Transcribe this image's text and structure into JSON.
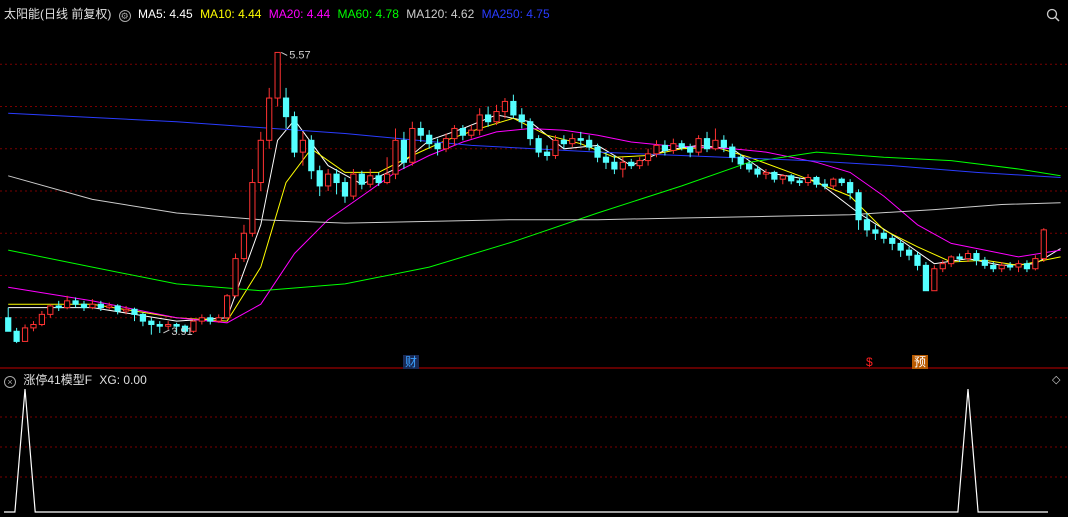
{
  "header": {
    "title": "太阳能(日线 前复权)",
    "ma_items": [
      {
        "label": "MA5: 4.45",
        "color": "#ffffff"
      },
      {
        "label": "MA10: 4.44",
        "color": "#ffff00"
      },
      {
        "label": "MA20: 4.44",
        "color": "#ff00ff"
      },
      {
        "label": "MA60: 4.78",
        "color": "#00ff00"
      },
      {
        "label": "MA120: 4.62",
        "color": "#cccccc"
      },
      {
        "label": "MA250: 4.75",
        "color": "#3355ff"
      }
    ],
    "settings_icon": "gear-circle-icon",
    "zoom_icon": "magnifier-icon"
  },
  "sub_panel": {
    "title": "涨停41模型F",
    "value_label": "XG: 0.00",
    "zoom_icon": "diamond-icon"
  },
  "events": [
    {
      "label": "财",
      "color": "#3aa0ff",
      "bg": "#1a2a55"
    },
    {
      "label": "$",
      "color": "#ff2020",
      "bg": "transparent"
    },
    {
      "label": "预",
      "color": "#ffffff",
      "bg": "#b85a00"
    }
  ],
  "chart_data": {
    "type": "candlestick",
    "ylim": [
      3.75,
      5.75
    ],
    "high_marker": {
      "label": "5.57",
      "value": 5.57
    },
    "low_marker": {
      "label": "3.91",
      "value": 3.91
    },
    "candles": [
      [
        4.0,
        3.92,
        4.06,
        3.92
      ],
      [
        3.92,
        3.86,
        3.94,
        3.85
      ],
      [
        3.86,
        3.94,
        3.96,
        3.86
      ],
      [
        3.94,
        3.96,
        3.98,
        3.92
      ],
      [
        3.96,
        4.02,
        4.04,
        3.95
      ],
      [
        4.02,
        4.07,
        4.08,
        4.0
      ],
      [
        4.07,
        4.06,
        4.1,
        4.04
      ],
      [
        4.06,
        4.1,
        4.13,
        4.05
      ],
      [
        4.1,
        4.08,
        4.12,
        4.06
      ],
      [
        4.08,
        4.06,
        4.1,
        4.04
      ],
      [
        4.06,
        4.08,
        4.11,
        4.05
      ],
      [
        4.08,
        4.06,
        4.1,
        4.04
      ],
      [
        4.06,
        4.07,
        4.09,
        4.05
      ],
      [
        4.07,
        4.04,
        4.08,
        4.02
      ],
      [
        4.04,
        4.05,
        4.07,
        4.02
      ],
      [
        4.05,
        4.02,
        4.06,
        3.98
      ],
      [
        4.02,
        3.98,
        4.03,
        3.95
      ],
      [
        3.98,
        3.96,
        4.0,
        3.9
      ],
      [
        3.96,
        3.95,
        3.98,
        3.91
      ],
      [
        3.95,
        3.96,
        3.98,
        3.93
      ],
      [
        3.96,
        3.95,
        3.97,
        3.91
      ],
      [
        3.95,
        3.92,
        3.96,
        3.91
      ],
      [
        3.92,
        3.98,
        3.99,
        3.91
      ],
      [
        3.98,
        4.0,
        4.02,
        3.96
      ],
      [
        4.0,
        3.98,
        4.02,
        3.96
      ],
      [
        3.98,
        4.0,
        4.02,
        3.97
      ],
      [
        4.0,
        4.13,
        4.14,
        3.99
      ],
      [
        4.13,
        4.35,
        4.38,
        4.12
      ],
      [
        4.35,
        4.5,
        4.55,
        4.33
      ],
      [
        4.5,
        4.8,
        4.88,
        4.48
      ],
      [
        4.8,
        5.05,
        5.1,
        4.75
      ],
      [
        5.05,
        5.3,
        5.36,
        5.0
      ],
      [
        5.3,
        5.57,
        5.57,
        5.25
      ],
      [
        5.3,
        5.19,
        5.36,
        5.12
      ],
      [
        5.19,
        4.98,
        5.22,
        4.95
      ],
      [
        4.98,
        5.05,
        5.1,
        4.9
      ],
      [
        5.05,
        4.87,
        5.08,
        4.82
      ],
      [
        4.87,
        4.78,
        4.9,
        4.72
      ],
      [
        4.78,
        4.85,
        4.88,
        4.75
      ],
      [
        4.85,
        4.8,
        4.88,
        4.73
      ],
      [
        4.8,
        4.72,
        4.83,
        4.68
      ],
      [
        4.72,
        4.85,
        4.88,
        4.7
      ],
      [
        4.85,
        4.79,
        4.87,
        4.76
      ],
      [
        4.79,
        4.84,
        4.88,
        4.77
      ],
      [
        4.84,
        4.8,
        4.86,
        4.78
      ],
      [
        4.8,
        4.85,
        4.95,
        4.79
      ],
      [
        4.85,
        5.05,
        5.12,
        4.82
      ],
      [
        5.05,
        4.92,
        5.1,
        4.88
      ],
      [
        4.92,
        5.12,
        5.16,
        4.9
      ],
      [
        5.12,
        5.08,
        5.16,
        5.04
      ],
      [
        5.08,
        5.03,
        5.11,
        5.0
      ],
      [
        5.03,
        5.0,
        5.06,
        4.96
      ],
      [
        5.0,
        5.06,
        5.09,
        4.98
      ],
      [
        5.06,
        5.12,
        5.14,
        5.02
      ],
      [
        5.12,
        5.08,
        5.14,
        5.05
      ],
      [
        5.08,
        5.11,
        5.14,
        5.06
      ],
      [
        5.11,
        5.2,
        5.24,
        5.08
      ],
      [
        5.2,
        5.16,
        5.25,
        5.13
      ],
      [
        5.16,
        5.22,
        5.26,
        5.14
      ],
      [
        5.22,
        5.28,
        5.3,
        5.18
      ],
      [
        5.28,
        5.2,
        5.32,
        5.18
      ],
      [
        5.2,
        5.16,
        5.24,
        5.12
      ],
      [
        5.16,
        5.06,
        5.18,
        5.02
      ],
      [
        5.06,
        4.98,
        5.08,
        4.95
      ],
      [
        4.98,
        4.96,
        5.02,
        4.93
      ],
      [
        4.96,
        5.05,
        5.08,
        4.94
      ],
      [
        5.05,
        5.03,
        5.08,
        5.0
      ],
      [
        5.03,
        5.06,
        5.09,
        5.01
      ],
      [
        5.06,
        5.05,
        5.1,
        5.02
      ],
      [
        5.05,
        5.01,
        5.08,
        4.99
      ],
      [
        5.01,
        4.95,
        5.03,
        4.92
      ],
      [
        4.95,
        4.92,
        4.98,
        4.88
      ],
      [
        4.92,
        4.88,
        4.96,
        4.85
      ],
      [
        4.88,
        4.92,
        4.95,
        4.83
      ],
      [
        4.92,
        4.9,
        4.94,
        4.88
      ],
      [
        4.9,
        4.93,
        4.95,
        4.88
      ],
      [
        4.93,
        4.97,
        5.0,
        4.9
      ],
      [
        4.97,
        5.02,
        5.05,
        4.95
      ],
      [
        5.02,
        4.99,
        5.05,
        4.96
      ],
      [
        4.99,
        5.03,
        5.06,
        4.97
      ],
      [
        5.03,
        5.01,
        5.05,
        4.99
      ],
      [
        5.01,
        4.98,
        5.03,
        4.95
      ],
      [
        4.98,
        5.06,
        5.08,
        4.96
      ],
      [
        5.06,
        5.0,
        5.1,
        4.98
      ],
      [
        5.0,
        5.05,
        5.12,
        4.99
      ],
      [
        5.05,
        5.01,
        5.08,
        4.98
      ],
      [
        5.01,
        4.95,
        5.03,
        4.92
      ],
      [
        4.95,
        4.91,
        4.97,
        4.88
      ],
      [
        4.91,
        4.88,
        4.93,
        4.86
      ],
      [
        4.88,
        4.85,
        4.9,
        4.83
      ],
      [
        4.85,
        4.86,
        4.88,
        4.82
      ],
      [
        4.86,
        4.82,
        4.87,
        4.8
      ],
      [
        4.82,
        4.84,
        4.85,
        4.79
      ],
      [
        4.84,
        4.81,
        4.85,
        4.79
      ],
      [
        4.81,
        4.8,
        4.83,
        4.78
      ],
      [
        4.8,
        4.83,
        4.85,
        4.78
      ],
      [
        4.83,
        4.79,
        4.84,
        4.77
      ],
      [
        4.79,
        4.78,
        4.82,
        4.76
      ],
      [
        4.78,
        4.82,
        4.83,
        4.76
      ],
      [
        4.82,
        4.8,
        4.83,
        4.78
      ],
      [
        4.8,
        4.74,
        4.82,
        4.7
      ],
      [
        4.74,
        4.58,
        4.76,
        4.52
      ],
      [
        4.58,
        4.52,
        4.62,
        4.48
      ],
      [
        4.52,
        4.5,
        4.55,
        4.46
      ],
      [
        4.5,
        4.47,
        4.52,
        4.44
      ],
      [
        4.47,
        4.44,
        4.49,
        4.4
      ],
      [
        4.44,
        4.4,
        4.46,
        4.36
      ],
      [
        4.4,
        4.37,
        4.42,
        4.34
      ],
      [
        4.37,
        4.31,
        4.39,
        4.28
      ],
      [
        4.31,
        4.16,
        4.33,
        4.16
      ],
      [
        4.16,
        4.29,
        4.31,
        4.16
      ],
      [
        4.29,
        4.32,
        4.34,
        4.27
      ],
      [
        4.32,
        4.36,
        4.37,
        4.3
      ],
      [
        4.36,
        4.35,
        4.38,
        4.33
      ],
      [
        4.35,
        4.38,
        4.4,
        4.33
      ],
      [
        4.38,
        4.34,
        4.4,
        4.31
      ],
      [
        4.34,
        4.31,
        4.36,
        4.29
      ],
      [
        4.31,
        4.29,
        4.33,
        4.27
      ],
      [
        4.29,
        4.31,
        4.33,
        4.27
      ],
      [
        4.31,
        4.3,
        4.33,
        4.28
      ],
      [
        4.3,
        4.32,
        4.34,
        4.27
      ],
      [
        4.32,
        4.29,
        4.34,
        4.27
      ],
      [
        4.29,
        4.35,
        4.37,
        4.28
      ],
      [
        4.35,
        4.52,
        4.53,
        4.33
      ]
    ],
    "ma_series": [
      {
        "name": "MA5",
        "color": "#ffffff",
        "points": [
          [
            0,
            4.06
          ],
          [
            10,
            4.06
          ],
          [
            20,
            3.98
          ],
          [
            26,
            4.0
          ],
          [
            30,
            4.55
          ],
          [
            32,
            5.05
          ],
          [
            34,
            5.17
          ],
          [
            38,
            4.9
          ],
          [
            42,
            4.79
          ],
          [
            46,
            4.88
          ],
          [
            50,
            5.05
          ],
          [
            54,
            5.12
          ],
          [
            58,
            5.2
          ],
          [
            62,
            5.16
          ],
          [
            66,
            5.0
          ],
          [
            70,
            5.02
          ],
          [
            74,
            4.9
          ],
          [
            78,
            4.99
          ],
          [
            82,
            5.02
          ],
          [
            86,
            5.0
          ],
          [
            90,
            4.86
          ],
          [
            96,
            4.81
          ],
          [
            101,
            4.62
          ],
          [
            106,
            4.46
          ],
          [
            110,
            4.32
          ],
          [
            114,
            4.35
          ],
          [
            118,
            4.31
          ],
          [
            122,
            4.32
          ],
          [
            125,
            4.41
          ]
        ]
      },
      {
        "name": "MA10",
        "color": "#ffff00",
        "points": [
          [
            0,
            4.08
          ],
          [
            10,
            4.08
          ],
          [
            20,
            4.0
          ],
          [
            26,
            3.98
          ],
          [
            30,
            4.3
          ],
          [
            33,
            4.8
          ],
          [
            36,
            5.0
          ],
          [
            40,
            4.86
          ],
          [
            44,
            4.86
          ],
          [
            48,
            4.96
          ],
          [
            52,
            5.05
          ],
          [
            56,
            5.12
          ],
          [
            60,
            5.18
          ],
          [
            64,
            5.08
          ],
          [
            68,
            5.03
          ],
          [
            72,
            4.95
          ],
          [
            76,
            4.96
          ],
          [
            80,
            5.0
          ],
          [
            84,
            5.01
          ],
          [
            88,
            4.95
          ],
          [
            94,
            4.84
          ],
          [
            100,
            4.72
          ],
          [
            104,
            4.52
          ],
          [
            108,
            4.42
          ],
          [
            112,
            4.33
          ],
          [
            116,
            4.34
          ],
          [
            120,
            4.31
          ],
          [
            125,
            4.36
          ]
        ]
      },
      {
        "name": "MA20",
        "color": "#ff00ff",
        "points": [
          [
            0,
            4.18
          ],
          [
            10,
            4.1
          ],
          [
            20,
            4.0
          ],
          [
            26,
            3.97
          ],
          [
            30,
            4.08
          ],
          [
            34,
            4.38
          ],
          [
            38,
            4.58
          ],
          [
            42,
            4.72
          ],
          [
            46,
            4.86
          ],
          [
            50,
            4.96
          ],
          [
            54,
            5.04
          ],
          [
            58,
            5.1
          ],
          [
            62,
            5.12
          ],
          [
            66,
            5.11
          ],
          [
            70,
            5.08
          ],
          [
            74,
            5.04
          ],
          [
            78,
            5.02
          ],
          [
            82,
            5.01
          ],
          [
            86,
            5.0
          ],
          [
            90,
            4.98
          ],
          [
            96,
            4.92
          ],
          [
            100,
            4.86
          ],
          [
            104,
            4.72
          ],
          [
            108,
            4.55
          ],
          [
            112,
            4.44
          ],
          [
            116,
            4.4
          ],
          [
            120,
            4.36
          ],
          [
            125,
            4.4
          ]
        ]
      },
      {
        "name": "MA60",
        "color": "#00ff00",
        "points": [
          [
            0,
            4.4
          ],
          [
            10,
            4.3
          ],
          [
            20,
            4.2
          ],
          [
            30,
            4.16
          ],
          [
            40,
            4.2
          ],
          [
            50,
            4.3
          ],
          [
            60,
            4.45
          ],
          [
            70,
            4.62
          ],
          [
            80,
            4.78
          ],
          [
            88,
            4.92
          ],
          [
            96,
            4.98
          ],
          [
            104,
            4.95
          ],
          [
            112,
            4.93
          ],
          [
            120,
            4.88
          ],
          [
            125,
            4.84
          ]
        ]
      },
      {
        "name": "MA120",
        "color": "#cccccc",
        "points": [
          [
            0,
            4.84
          ],
          [
            10,
            4.7
          ],
          [
            20,
            4.62
          ],
          [
            30,
            4.58
          ],
          [
            40,
            4.56
          ],
          [
            50,
            4.57
          ],
          [
            60,
            4.58
          ],
          [
            70,
            4.58
          ],
          [
            80,
            4.59
          ],
          [
            90,
            4.6
          ],
          [
            100,
            4.61
          ],
          [
            110,
            4.64
          ],
          [
            118,
            4.67
          ],
          [
            125,
            4.68
          ]
        ]
      },
      {
        "name": "MA250",
        "color": "#2a3cff",
        "points": [
          [
            0,
            5.21
          ],
          [
            20,
            5.16
          ],
          [
            40,
            5.09
          ],
          [
            55,
            5.02
          ],
          [
            70,
            4.98
          ],
          [
            85,
            4.95
          ],
          [
            95,
            4.93
          ],
          [
            105,
            4.9
          ],
          [
            115,
            4.86
          ],
          [
            125,
            4.83
          ]
        ]
      }
    ],
    "sub_chart": {
      "type": "line",
      "name": "XG",
      "ylim": [
        0,
        1
      ],
      "spikes": [
        {
          "index": 2,
          "value": 1
        },
        {
          "index": 114,
          "value": 1
        }
      ]
    }
  }
}
